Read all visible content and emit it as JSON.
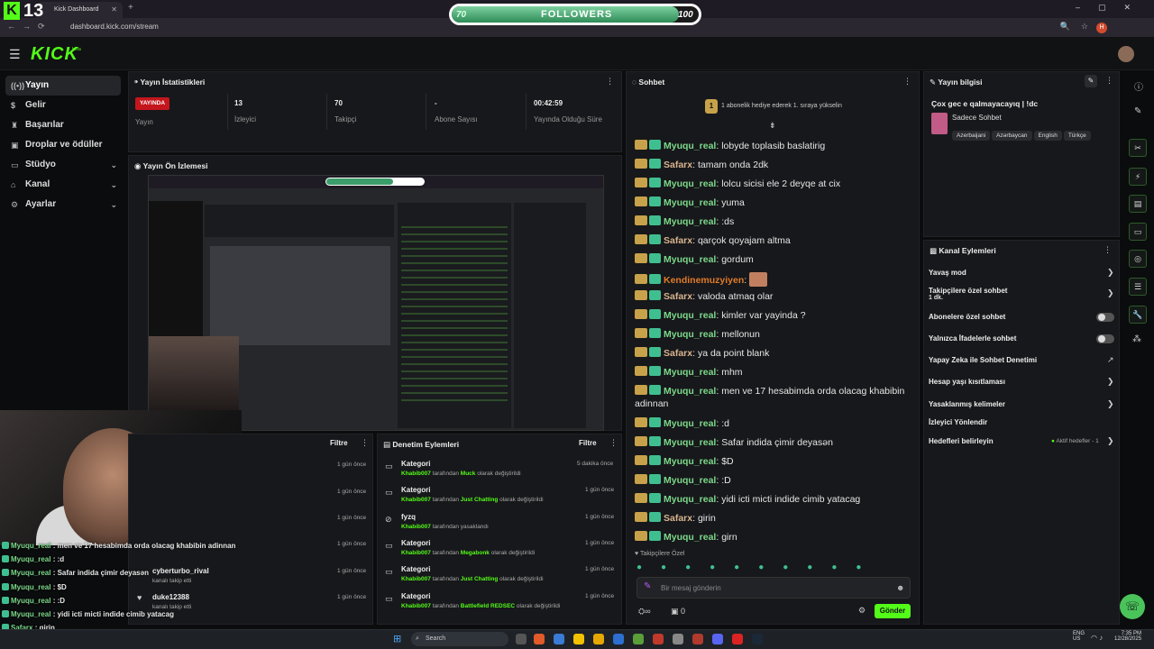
{
  "browser": {
    "tab_title": "Kick Dashboard",
    "url": "dashboard.kick.com/stream"
  },
  "overlay": {
    "kick_letter": "K",
    "viewer_count": "13",
    "followers_goal": {
      "min": "70",
      "label": "FOLLOWERS",
      "max": "100",
      "progress": 0.92
    }
  },
  "header": {
    "logo": "KICK",
    "logo_sup": "beta"
  },
  "sidebar": {
    "items": [
      {
        "label": "Yayın",
        "icon": "broadcast-icon"
      },
      {
        "label": "Gelir",
        "icon": "dollar-icon"
      },
      {
        "label": "Başarılar",
        "icon": "trophy-icon"
      },
      {
        "label": "Droplar ve ödüller",
        "icon": "gift-icon"
      },
      {
        "label": "Stüdyo",
        "icon": "tv-icon"
      },
      {
        "label": "Kanal",
        "icon": "home-icon"
      },
      {
        "label": "Ayarlar",
        "icon": "gear-icon"
      }
    ]
  },
  "stats": {
    "title": "Yayın İstatistikleri",
    "live_badge": "YAYINDA",
    "live_label": "Yayın",
    "viewers_value": "13",
    "viewers_label": "İzleyici",
    "followers_value": "70",
    "followers_label": "Takipçi",
    "subs_value": "-",
    "subs_label": "Abone Sayısı",
    "uptime_value": "00:42:59",
    "uptime_label": "Yayında Olduğu Süre"
  },
  "preview": {
    "title": "Yayın Ön İzlemesi"
  },
  "activity": {
    "filter": "Filtre",
    "rows": [
      {
        "time": "1 gün önce"
      },
      {
        "time": "1 gün önce"
      },
      {
        "time": "1 gün önce"
      },
      {
        "time": "1 gün önce"
      },
      {
        "name": "cyberturbo_rival",
        "sub": "kanalı takip etti",
        "time": "1 gün önce"
      },
      {
        "name": "duke12388",
        "sub": "kanalı takip etti",
        "time": "1 gün önce"
      }
    ]
  },
  "moderation": {
    "title": "Denetim Eylemleri",
    "filter": "Filtre",
    "rows": [
      {
        "title": "Kategori",
        "user": "Khabib007",
        "mid": "tarafından",
        "value": "Muck",
        "end": "olarak değiştirildi",
        "time": "5 dakika önce"
      },
      {
        "title": "Kategori",
        "user": "Khabib007",
        "mid": "tarafından",
        "value": "Just Chatting",
        "end": "olarak değiştirildi",
        "time": "1 gün önce"
      },
      {
        "title": "fyzq",
        "user": "Khabib007",
        "mid": "tarafından yasaklandı",
        "value": "",
        "end": "",
        "time": "1 gün önce"
      },
      {
        "title": "Kategori",
        "user": "Khabib007",
        "mid": "tarafından",
        "value": "Megabonk",
        "end": "olarak değiştirildi",
        "time": "1 gün önce"
      },
      {
        "title": "Kategori",
        "user": "Khabib007",
        "mid": "tarafından",
        "value": "Just Chatting",
        "end": "olarak değiştirildi",
        "time": "1 gün önce"
      },
      {
        "title": "Kategori",
        "user": "Khabib007",
        "mid": "tarafından",
        "value": "Battlefield REDSEC",
        "end": "olarak değiştirildi",
        "time": "1 gün önce"
      }
    ]
  },
  "chat": {
    "title": "Sohbet",
    "pinned": "1 abonelik hediye ederek 1. sıraya yükselin",
    "pinned_num": "1",
    "messages": [
      {
        "user": "Myuqu_real",
        "text": "lobyde toplasib baslatirig",
        "cls": "u-myu"
      },
      {
        "user": "Safarx",
        "text": "tamam onda 2dk",
        "cls": "u-saf"
      },
      {
        "user": "Myuqu_real",
        "text": "lolcu sicisi ele 2 deyqe at cix",
        "cls": "u-myu"
      },
      {
        "user": "Myuqu_real",
        "text": "yuma",
        "cls": "u-myu"
      },
      {
        "user": "Myuqu_real",
        "text": ":ds",
        "cls": "u-myu"
      },
      {
        "user": "Safarx",
        "text": "qarçok qoyajam altma",
        "cls": "u-saf"
      },
      {
        "user": "Myuqu_real",
        "text": "gordum",
        "cls": "u-myu"
      },
      {
        "user": "Kendinemuzyiyen",
        "text": "",
        "cls": "u-ken"
      },
      {
        "user": "Safarx",
        "text": "valoda atmaq olar",
        "cls": "u-saf"
      },
      {
        "user": "Myuqu_real",
        "text": "kimler var yayinda ?",
        "cls": "u-myu"
      },
      {
        "user": "Myuqu_real",
        "text": "mellonun",
        "cls": "u-myu"
      },
      {
        "user": "Safarx",
        "text": "ya da point blank",
        "cls": "u-saf"
      },
      {
        "user": "Myuqu_real",
        "text": "mhm",
        "cls": "u-myu"
      },
      {
        "user": "Myuqu_real",
        "text": "men ve 17 hesabimda orda olacag khabibin",
        "cls": "u-myu"
      },
      {
        "user": "",
        "text": "adinnan",
        "cls": ""
      },
      {
        "user": "Myuqu_real",
        "text": ":d",
        "cls": "u-myu"
      },
      {
        "user": "Myuqu_real",
        "text": "Safar indida çimir deyasən",
        "cls": "u-myu"
      },
      {
        "user": "Myuqu_real",
        "text": "$D",
        "cls": "u-myu"
      },
      {
        "user": "Myuqu_real",
        "text": ":D",
        "cls": "u-myu"
      },
      {
        "user": "Myuqu_real",
        "text": "yidi icti micti indide cimib yatacag",
        "cls": "u-myu"
      },
      {
        "user": "Safarx",
        "text": "girin",
        "cls": "u-saf"
      },
      {
        "user": "Myuqu_real",
        "text": "girn",
        "cls": "u-myu"
      }
    ],
    "followers_only": "Takipçilere Özel",
    "input_placeholder": "Bir mesaj gönderin",
    "send": "Gönder",
    "points": "0",
    "infinity": "∞"
  },
  "overlay_chat": [
    {
      "user": "Myuqu_real",
      "text": " : men ve 17 hesabimda orda olacag khabibin adinnan"
    },
    {
      "user": "Myuqu_real",
      "text": " : :d"
    },
    {
      "user": "Myuqu_real",
      "text": " : Safar indida çimir deyasən"
    },
    {
      "user": "Myuqu_real",
      "text": " : $D"
    },
    {
      "user": "Myuqu_real",
      "text": " : :D"
    },
    {
      "user": "Myuqu_real",
      "text": " : yidi icti micti indide cimib yatacag"
    },
    {
      "user": "Safarx",
      "text": " : girin"
    },
    {
      "user": "Myuqu_real",
      "text": " : girn"
    }
  ],
  "stream_info": {
    "title": "Yayın bilgisi",
    "stream_title": "Çox gec e qalmayacayıq | !dc",
    "category": "Sadece Sohbet",
    "tags": [
      "Azerbaijani",
      "Azərbaycan",
      "English",
      "Türkçe"
    ]
  },
  "channel_actions": {
    "title": "Kanal Eylemleri",
    "items": [
      {
        "label": "Yavaş mod",
        "kind": "chev"
      },
      {
        "label": "Takipçilere özel sohbet",
        "sub": "1 dk.",
        "kind": "chev"
      },
      {
        "label": "Abonelere özel sohbet",
        "kind": "toggle"
      },
      {
        "label": "Yalnızca İfadelerle sohbet",
        "kind": "toggle"
      },
      {
        "label": "Yapay Zeka ile Sohbet Denetimi",
        "kind": "ext"
      },
      {
        "label": "Hesap yaşı kısıtlaması",
        "kind": "chev"
      },
      {
        "label": "Yasaklanmış kelimeler",
        "kind": "chev"
      },
      {
        "label": "İzleyici Yönlendir",
        "kind": "none"
      },
      {
        "label": "Hedefleri belirleyin",
        "kind": "goal",
        "extra": "Aktif hedefler - 1"
      }
    ]
  },
  "taskbar": {
    "search": "Search",
    "lang1": "ENG",
    "lang2": "US",
    "time": "7:35 PM",
    "date": "12/28/2025"
  },
  "colors": {
    "accent": "#53fc18",
    "live": "#c4161c"
  }
}
